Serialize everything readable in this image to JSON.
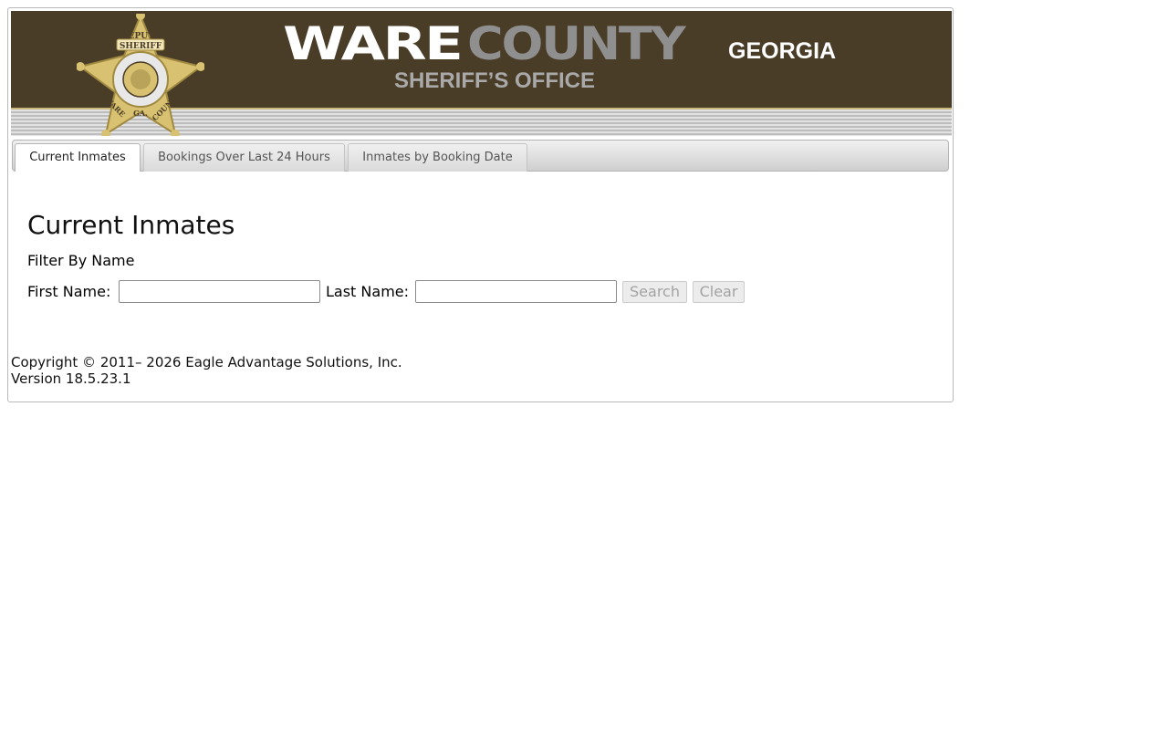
{
  "banner": {
    "title_ware": "WARE",
    "title_county": "COUNTY",
    "title_state": "GEORGIA",
    "title_office": "SHERIFF’S OFFICE",
    "badge": {
      "icon": "sheriff-star-badge",
      "text_top": "DEPUTY",
      "text_ribbon": "SHERIFF",
      "text_left": "WARE",
      "text_mid": "GA.",
      "text_right": "COUNTY",
      "colors": {
        "gold": "#d8c170",
        "dark": "#4a3d28",
        "silver": "#e8e8e8"
      }
    }
  },
  "tabs": [
    {
      "label": "Current Inmates",
      "active": true
    },
    {
      "label": "Bookings Over Last 24 Hours",
      "active": false
    },
    {
      "label": "Inmates by Booking Date",
      "active": false
    }
  ],
  "main": {
    "heading": "Current Inmates",
    "filter_label": "Filter By Name",
    "first_name_label": "First Name:",
    "first_name_value": "",
    "last_name_label": "Last Name:",
    "last_name_value": "",
    "search_label": "Search",
    "clear_label": "Clear"
  },
  "footer": {
    "copyright": "Copyright © 2011– 2026 Eagle Advantage Solutions, Inc.",
    "version": "Version 18.5.23.1"
  },
  "colors": {
    "banner_bg": "#4a3d28",
    "title_white": "#ffffff",
    "title_gray": "#8f8f8f",
    "office_gray": "#a9a9a9"
  }
}
